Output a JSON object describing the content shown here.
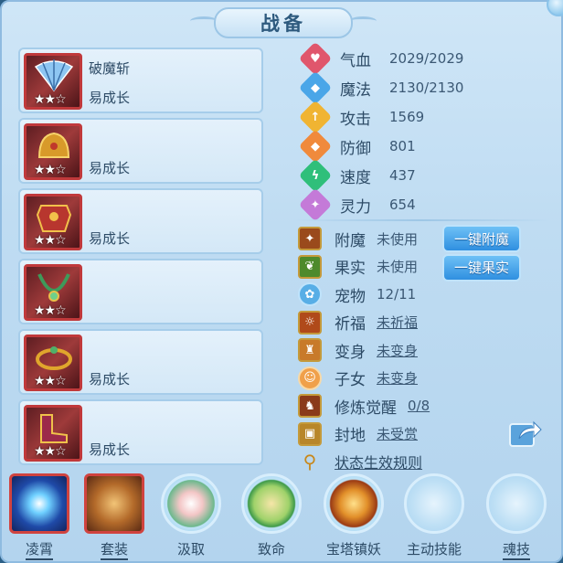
{
  "window": {
    "title": "战备"
  },
  "equipment": [
    {
      "name": "破魔斩",
      "tag": "易成长",
      "stars": "★★☆",
      "icon": "fan-icon"
    },
    {
      "name": "",
      "tag": "易成长",
      "stars": "★★☆",
      "icon": "helmet-icon"
    },
    {
      "name": "",
      "tag": "易成长",
      "stars": "★★☆",
      "icon": "armor-icon"
    },
    {
      "name": "",
      "tag": "",
      "stars": "★★☆",
      "icon": "necklace-icon"
    },
    {
      "name": "",
      "tag": "易成长",
      "stars": "★★☆",
      "icon": "belt-icon"
    },
    {
      "name": "",
      "tag": "易成长",
      "stars": "★★☆",
      "icon": "boots-icon"
    }
  ],
  "stats": [
    {
      "label": "气血",
      "value": "2029/2029",
      "icon": "heart-icon",
      "color": "#e0566c"
    },
    {
      "label": "魔法",
      "value": "2130/2130",
      "icon": "mana-icon",
      "color": "#4aa6e8"
    },
    {
      "label": "攻击",
      "value": "1569",
      "icon": "attack-icon",
      "color": "#f0b432"
    },
    {
      "label": "防御",
      "value": "801",
      "icon": "defense-icon",
      "color": "#f08a3c"
    },
    {
      "label": "速度",
      "value": "437",
      "icon": "speed-icon",
      "color": "#2fbf7a"
    },
    {
      "label": "灵力",
      "value": "654",
      "icon": "spirit-icon",
      "color": "#c47ad8"
    }
  ],
  "misc": [
    {
      "label": "附魔",
      "value": "未使用",
      "underline": false,
      "button": "一键附魔",
      "icon": "enchant-icon"
    },
    {
      "label": "果实",
      "value": "未使用",
      "underline": false,
      "button": "一键果实",
      "icon": "fruit-icon"
    },
    {
      "label": "宠物",
      "value": "12/11",
      "underline": false,
      "button": "",
      "icon": "pet-paw-icon"
    },
    {
      "label": "祈福",
      "value": "未祈福",
      "underline": true,
      "button": "",
      "icon": "bless-icon"
    },
    {
      "label": "变身",
      "value": "未变身",
      "underline": true,
      "button": "",
      "icon": "transform-icon"
    },
    {
      "label": "子女",
      "value": "未变身",
      "underline": true,
      "button": "",
      "icon": "child-icon"
    },
    {
      "label": "修炼觉醒",
      "value": "0/8",
      "underline": true,
      "button": "",
      "icon": "cultivation-icon"
    },
    {
      "label": "封地",
      "value": "未受赏",
      "underline": true,
      "button": "",
      "icon": "fief-icon"
    },
    {
      "label": "状态生效规则",
      "value": "",
      "underline": true,
      "button": "",
      "icon": "magnifier-icon"
    }
  ],
  "skills": [
    {
      "label": "凌霄",
      "icon": "lingxiao-icon",
      "underline": true,
      "square": true
    },
    {
      "label": "套装",
      "icon": "suit-icon",
      "underline": true,
      "square": true
    },
    {
      "label": "汲取",
      "icon": "absorb-icon",
      "underline": false,
      "square": false
    },
    {
      "label": "致命",
      "icon": "fatal-icon",
      "underline": false,
      "square": false
    },
    {
      "label": "宝塔镇妖",
      "icon": "pagoda-icon",
      "underline": false,
      "square": false
    },
    {
      "label": "主动技能",
      "icon": "active-skill-icon",
      "underline": false,
      "square": false
    },
    {
      "label": "魂技",
      "icon": "soul-skill-icon",
      "underline": true,
      "square": false
    }
  ],
  "colors": {
    "accent": "#2f8fe0",
    "panel": "#c6e1f5",
    "frame_red": "#c0393b"
  }
}
